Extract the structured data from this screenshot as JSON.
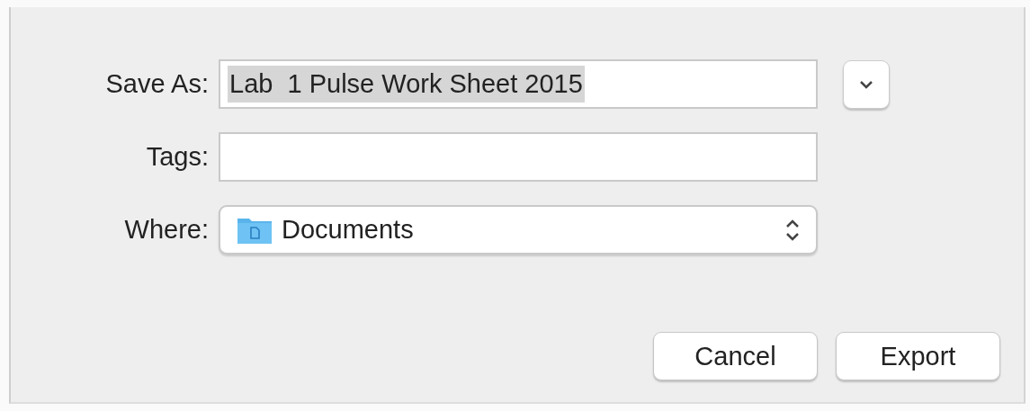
{
  "form": {
    "rows": [
      {
        "kind": "text",
        "label": "Save As:",
        "value": "Lab  1 Pulse Work Sheet 2015",
        "text_selected": true,
        "expand_button": true
      },
      {
        "kind": "text",
        "label": "Tags:",
        "value": ""
      },
      {
        "kind": "popup",
        "label": "Where:",
        "value": "Documents"
      }
    ]
  },
  "buttons": [
    {
      "label": "Cancel",
      "default": false
    },
    {
      "label": "Export",
      "default": false
    }
  ]
}
